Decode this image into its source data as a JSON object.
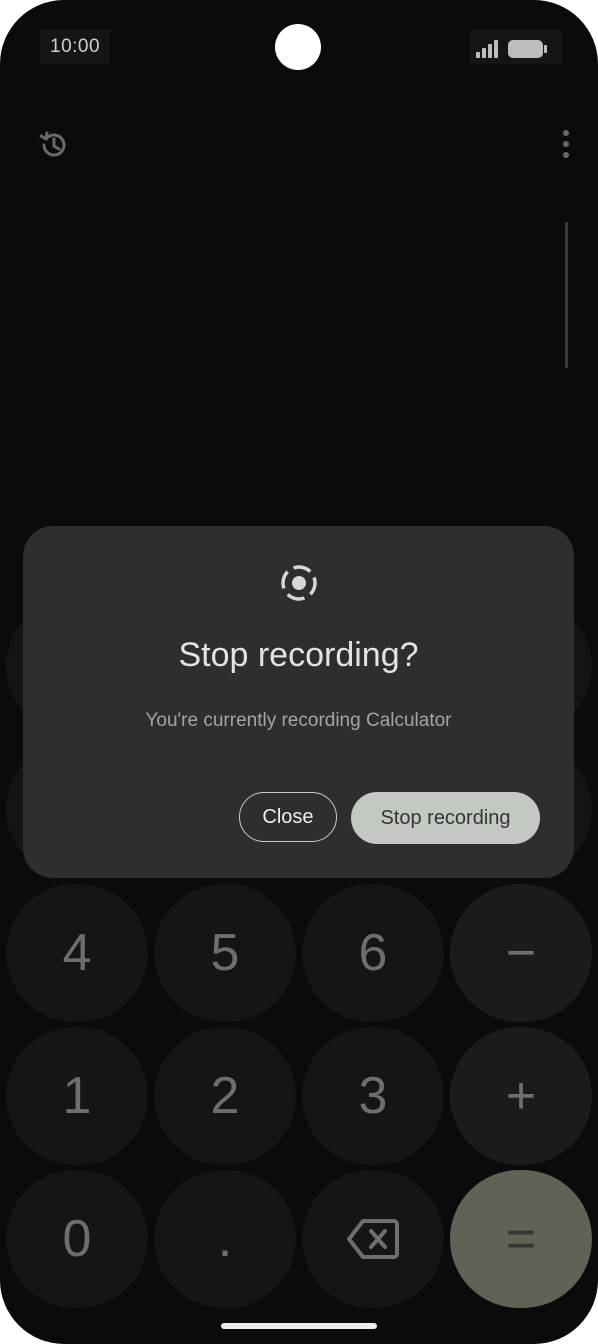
{
  "status": {
    "time": "10:00",
    "signal_icon": "signal-bars-icon",
    "battery_icon": "battery-icon"
  },
  "toolbar": {
    "history_icon": "history-icon",
    "more_icon": "more-vert-icon"
  },
  "keypad": {
    "row4": [
      "4",
      "5",
      "6",
      "−"
    ],
    "row5": [
      "1",
      "2",
      "3",
      "+"
    ],
    "row6": [
      "0",
      ".",
      "⌫",
      "="
    ]
  },
  "dialog": {
    "icon": "screen-record-icon",
    "title": "Stop recording?",
    "message": "You're currently recording Calculator",
    "close_label": "Close",
    "stop_label": "Stop recording"
  },
  "colors": {
    "background": "#0b0b0b",
    "dialog": "#2c2f2b",
    "primary_button": "#c3c8c2",
    "equals_key": "#5f6255"
  }
}
